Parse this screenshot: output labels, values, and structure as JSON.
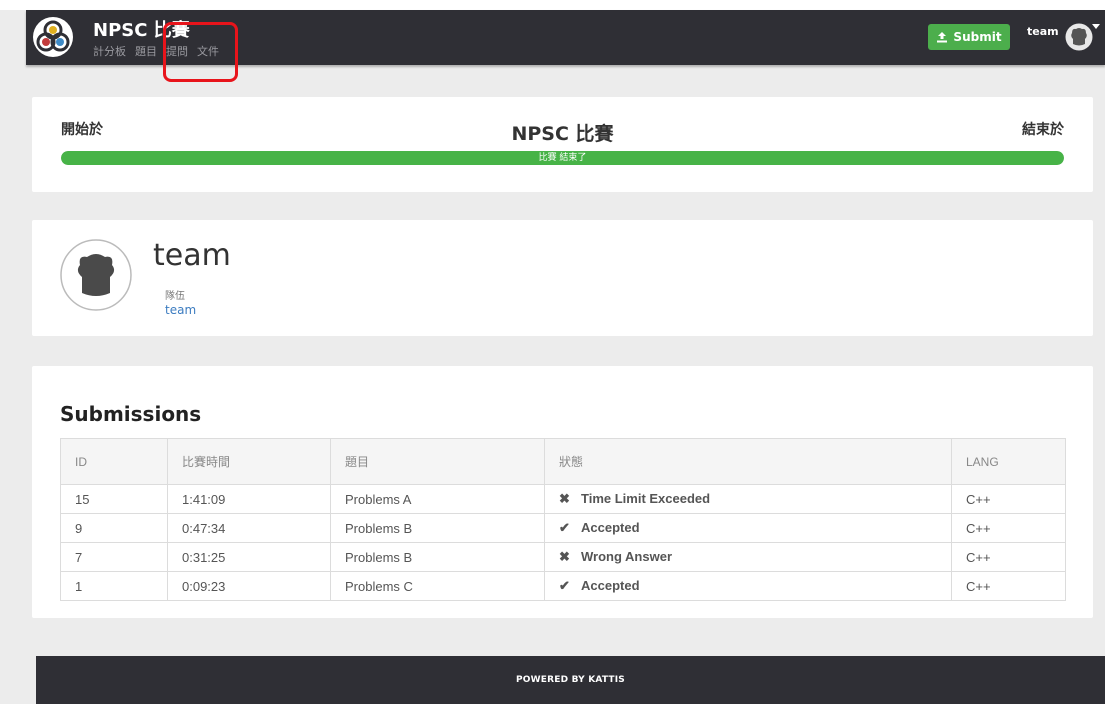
{
  "header": {
    "brand_title": "NPSC 比賽",
    "nav": [
      "計分板",
      "題目",
      "提問",
      "文件"
    ],
    "submit_label": "Submit",
    "username": "team"
  },
  "contest": {
    "start_label": "開始於",
    "title": "NPSC 比賽",
    "end_label": "結束於",
    "progress_text": "比賽 結束了",
    "progress_fraction": 1.0
  },
  "profile": {
    "name": "team",
    "role_label": "隊伍",
    "team_link": "team"
  },
  "submissions": {
    "title": "Submissions",
    "columns": [
      "ID",
      "比賽時間",
      "題目",
      "狀態",
      "LANG"
    ],
    "rows": [
      {
        "id": "15",
        "time": "1:41:09",
        "problem": "Problems A",
        "status": "Time Limit Exceeded",
        "ok": false,
        "lang": "C++"
      },
      {
        "id": "9",
        "time": "0:47:34",
        "problem": "Problems B",
        "status": "Accepted",
        "ok": true,
        "lang": "C++"
      },
      {
        "id": "7",
        "time": "0:31:25",
        "problem": "Problems B",
        "status": "Wrong Answer",
        "ok": false,
        "lang": "C++"
      },
      {
        "id": "1",
        "time": "0:09:23",
        "problem": "Problems C",
        "status": "Accepted",
        "ok": true,
        "lang": "C++"
      }
    ]
  },
  "footer": {
    "text": "POWERED BY KATTIS"
  },
  "colors": {
    "navbar": "#2f2f35",
    "success": "#47b347",
    "error": "#c9302c",
    "link": "#3c7cc0",
    "highlight": "#e8141b"
  },
  "icons": {
    "logo": "kattis-logo-icon",
    "upload": "upload-icon",
    "status_ok": "check-icon",
    "status_bad": "cross-icon"
  }
}
